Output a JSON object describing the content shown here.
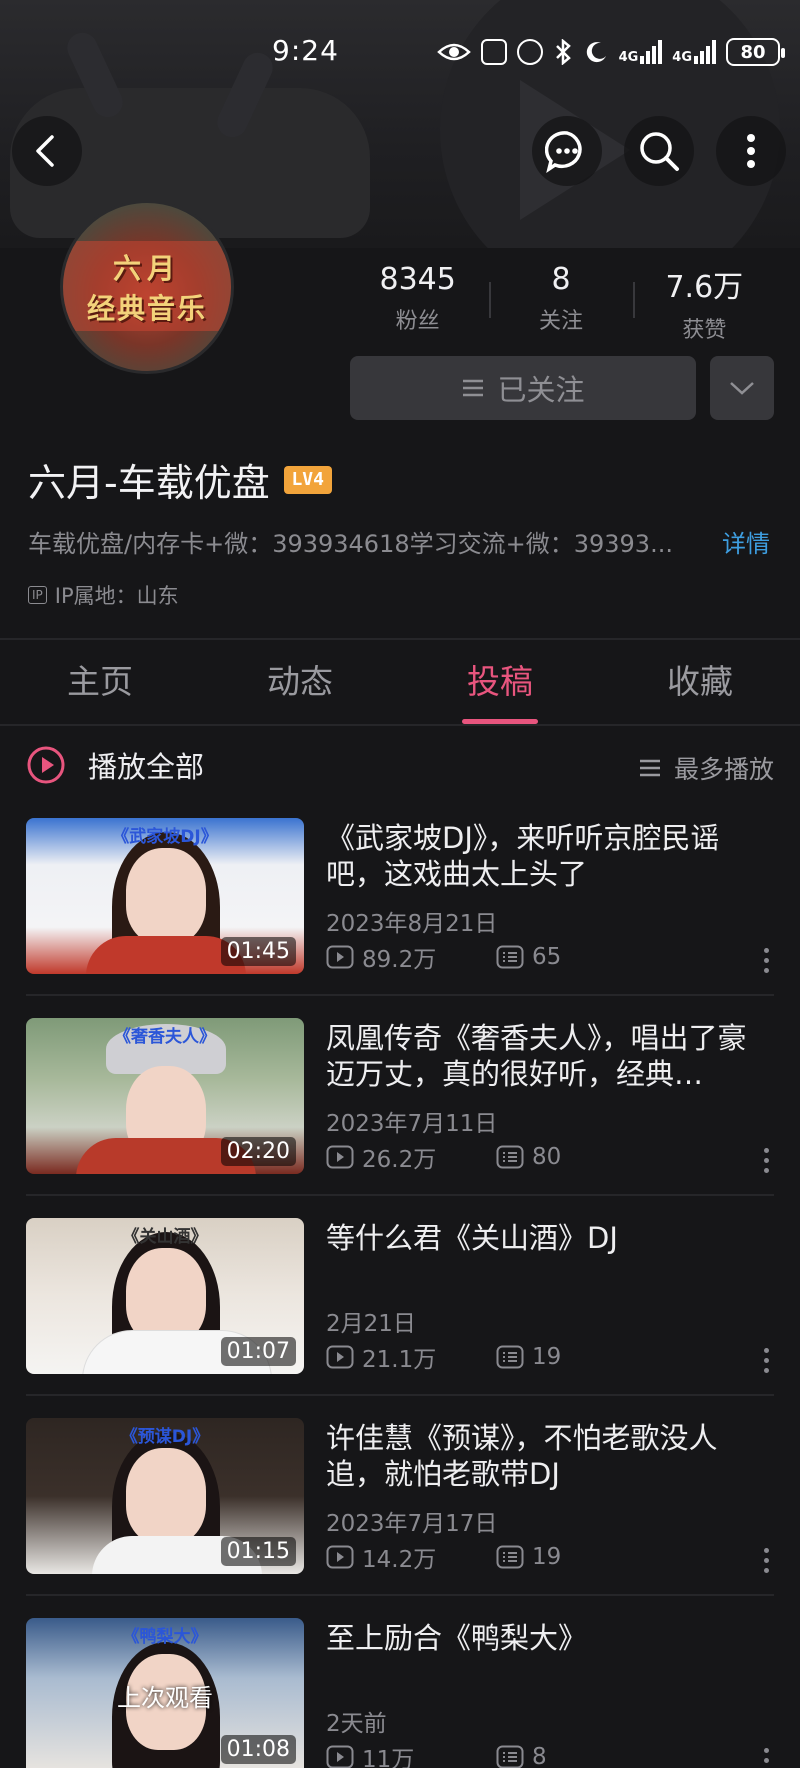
{
  "status_bar": {
    "time": "9:24",
    "network1": "4G",
    "network2": "4G",
    "battery": "80"
  },
  "profile": {
    "stats": [
      {
        "value": "8345",
        "label": "粉丝"
      },
      {
        "value": "8",
        "label": "关注"
      },
      {
        "value": "7.6万",
        "label": "获赞"
      }
    ],
    "follow_label": "已关注",
    "username": "六月-车载优盘",
    "level": "LV4",
    "bio": "车载优盘/内存卡+微：393934618学习交流+微：39393...",
    "detail_link": "详情",
    "ip_badge": "IP",
    "ip_location": "IP属地：山东",
    "avatar_text_line1": "六月",
    "avatar_text_line2": "经典音乐"
  },
  "tabs": [
    "主页",
    "动态",
    "投稿",
    "收藏"
  ],
  "active_tab": "投稿",
  "list_header": {
    "play_all": "播放全部",
    "sort": "最多播放"
  },
  "videos": [
    {
      "title": "《武家坡DJ》，来听听京腔民谣吧，这戏曲太上头了",
      "date": "2023年8月21日",
      "plays": "89.2万",
      "comments": "65",
      "duration": "01:45",
      "caption": "《武家坡DJ》"
    },
    {
      "title": "凤凰传奇《奢香夫人》，唱出了豪迈万丈，真的很好听，经典…",
      "date": "2023年7月11日",
      "plays": "26.2万",
      "comments": "80",
      "duration": "02:20",
      "caption": "《奢香夫人》"
    },
    {
      "title": "等什么君《关山酒》DJ",
      "date": "2月21日",
      "plays": "21.1万",
      "comments": "19",
      "duration": "01:07",
      "caption": "《关山酒》"
    },
    {
      "title": "许佳慧《预谋》，不怕老歌没人追，就怕老歌带DJ",
      "date": "2023年7月17日",
      "plays": "14.2万",
      "comments": "19",
      "duration": "01:15",
      "caption": "《预谋DJ》"
    },
    {
      "title": "至上励合《鸭梨大》",
      "date": "2天前",
      "plays": "11万",
      "comments": "8",
      "duration": "01:08",
      "caption": "《鸭梨大》",
      "overlay": "上次观看"
    }
  ],
  "colors": {
    "accent": "#e8557e",
    "link": "#3e9ee0",
    "background": "#161618"
  }
}
